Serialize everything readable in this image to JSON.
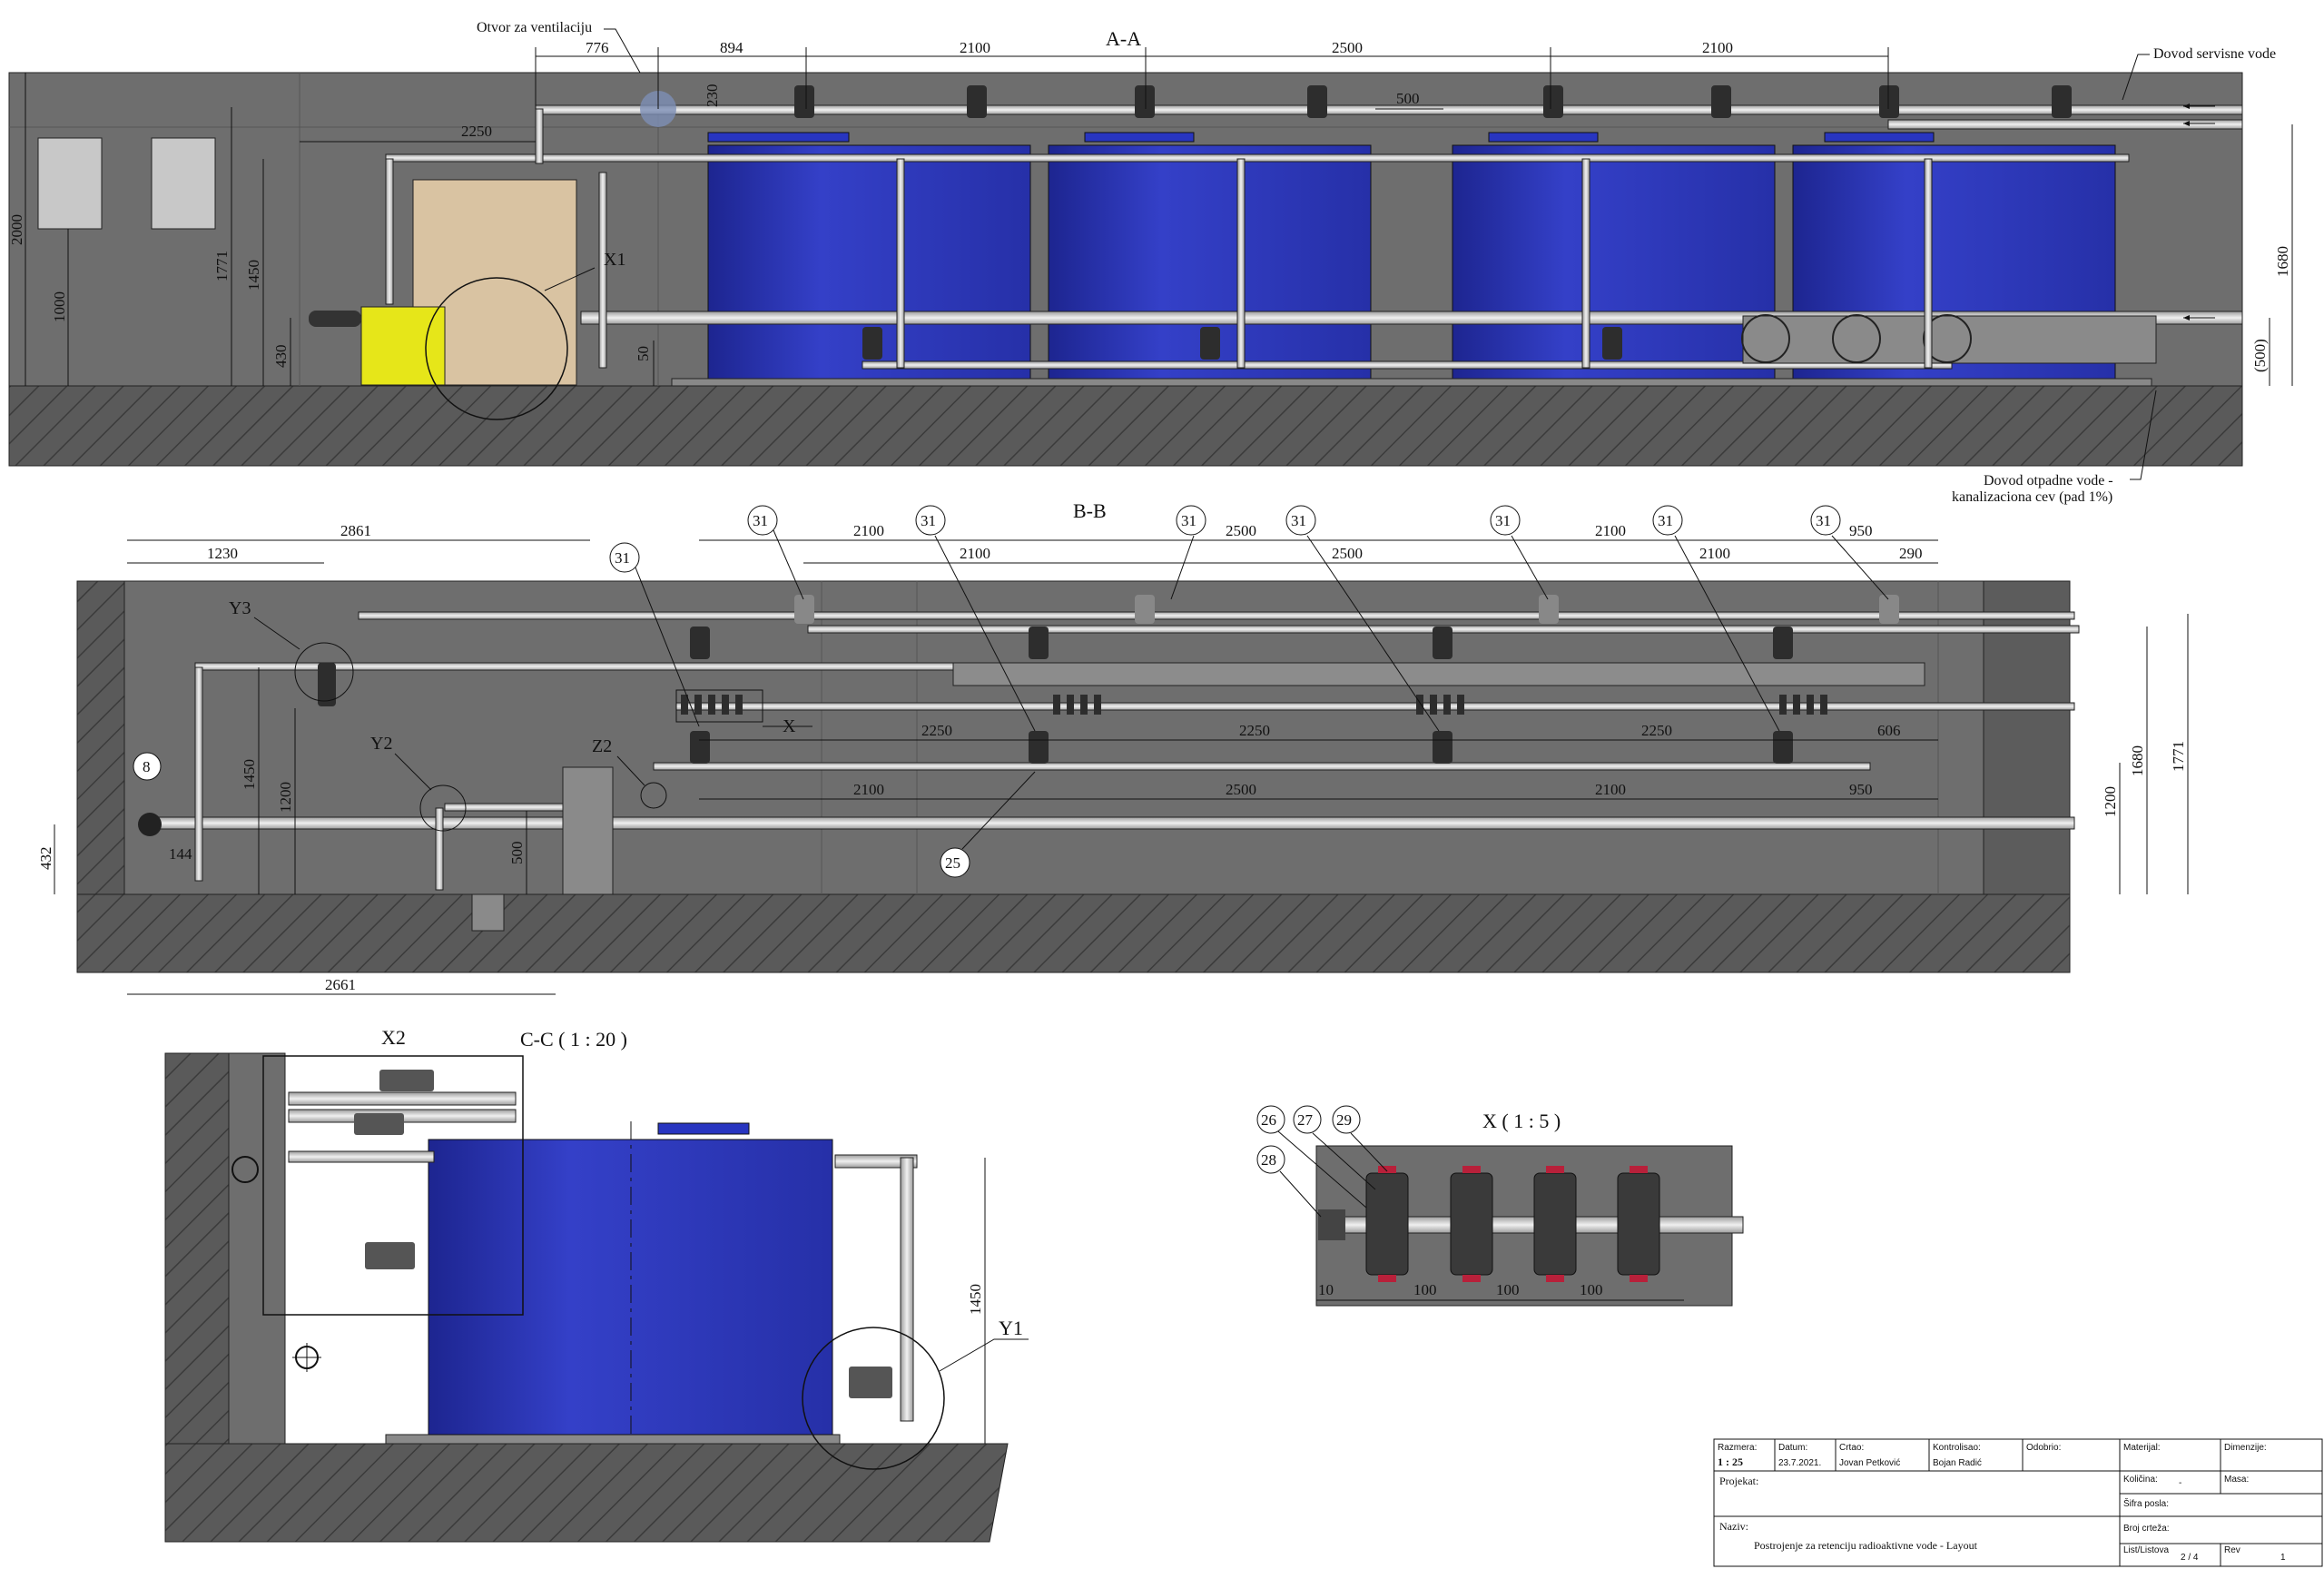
{
  "sections": {
    "aa": {
      "title": "A-A",
      "callouts": {
        "ventilation": "Otvor za ventilaciju",
        "service_water": "Dovod servisne vode",
        "waste_water_line1": "Dovod otpadne vode -",
        "waste_water_line2": "kanalizaciona cev (pad 1%)",
        "x1": "X1"
      },
      "dims": {
        "top": [
          "776",
          "894",
          "2100",
          "2500",
          "2100"
        ],
        "d230": "230",
        "d500": "500",
        "d2250": "2250",
        "d2000": "2000",
        "d1000": "1000",
        "d1771": "1771",
        "d1450": "1450",
        "d430": "430",
        "d50": "50",
        "d1680": "1680",
        "d500p": "(500)"
      }
    },
    "bb": {
      "title": "B-B",
      "callouts": {
        "y3": "Y3",
        "y2": "Y2",
        "z2": "Z2",
        "x": "X"
      },
      "balloons": {
        "b31": "31",
        "b8": "8",
        "b25": "25"
      },
      "dims": {
        "d2861": "2861",
        "d1230": "1230",
        "top_row1": [
          "2100",
          "2500",
          "2100",
          "950"
        ],
        "top_row2": [
          "2100",
          "2500",
          "2100",
          "290"
        ],
        "mid": [
          "2250",
          "2250",
          "2250",
          "606"
        ],
        "low": [
          "2100",
          "2500",
          "2100",
          "950"
        ],
        "d1450": "1450",
        "d1200": "1200",
        "d432": "432",
        "d144": "144",
        "d500": "500",
        "d2661": "2661",
        "r1200": "1200",
        "r1680": "1680",
        "r1771": "1771"
      }
    },
    "cc": {
      "title": "C-C ( 1 : 20 )",
      "callouts": {
        "x2": "X2",
        "y1": "Y1"
      },
      "dims": {
        "d1450": "1450"
      }
    },
    "x": {
      "title": "X ( 1 : 5 )",
      "balloons": [
        "26",
        "27",
        "29",
        "28"
      ],
      "dims": [
        "10",
        "100",
        "100",
        "100"
      ]
    }
  },
  "title_block": {
    "razmera_label": "Razmera:",
    "razmera": "1 : 25",
    "datum_label": "Datum:",
    "datum": "23.7.2021.",
    "crtao_label": "Crtao:",
    "crtao": "Jovan Petković",
    "kontrolisao_label": "Kontrolisao:",
    "kontrolisao": "Bojan Radić",
    "odobrio_label": "Odobrio:",
    "materijal_label": "Materijal:",
    "dimenzije_label": "Dimenzije:",
    "projekat_label": "Projekat:",
    "kolicina_label": "Količina:",
    "kolicina": "-",
    "masa_label": "Masa:",
    "sifra_label": "Šifra posla:",
    "naziv_label": "Naziv:",
    "naziv": "Postrojenje za retenciju radioaktivne vode - Layout",
    "broj_label": "Broj crteža:",
    "list_label": "List/Listova",
    "list": "2 / 4",
    "rev_label": "Rev",
    "rev": "1"
  },
  "colors": {
    "wall": "#6e6e6e",
    "floor": "#5a5a5a",
    "tank_blue": "#2b35b8",
    "tank_beige": "#d9c3a2",
    "pump_yellow": "#e6e619",
    "pipe": "#c9c9c9"
  }
}
